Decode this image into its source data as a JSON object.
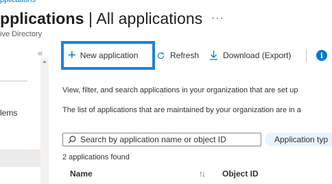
{
  "breadcrumb": {
    "text": "pplications"
  },
  "page": {
    "title_bold": "pplications",
    "title_rest": " | All applications",
    "subtitle": "ive Directory",
    "more_label": "···"
  },
  "left_nav": {
    "collapse_label": "«",
    "partial_item": "lems"
  },
  "toolbar": {
    "new_application": "New application",
    "refresh": "Refresh",
    "download": "Download (Export)",
    "info_label": "i"
  },
  "main": {
    "desc1": "View, filter, and search applications in your organization that are set up",
    "desc2": "The list of applications that are maintained by your organization are in a",
    "search": {
      "placeholder": "Search by application name or object ID",
      "value": ""
    },
    "filter_pill": "Application typ",
    "count": "2 applications found",
    "columns": [
      "Name",
      "Object ID"
    ]
  },
  "colors": {
    "accent": "#0078d4",
    "highlight_box": "#1e7fe6",
    "pill_bg": "#e8f3fc"
  },
  "icons": {
    "new": "plus-icon",
    "refresh": "refresh-icon",
    "download": "download-icon",
    "info": "info-icon",
    "search": "search-icon",
    "sort": "sort-icon"
  }
}
